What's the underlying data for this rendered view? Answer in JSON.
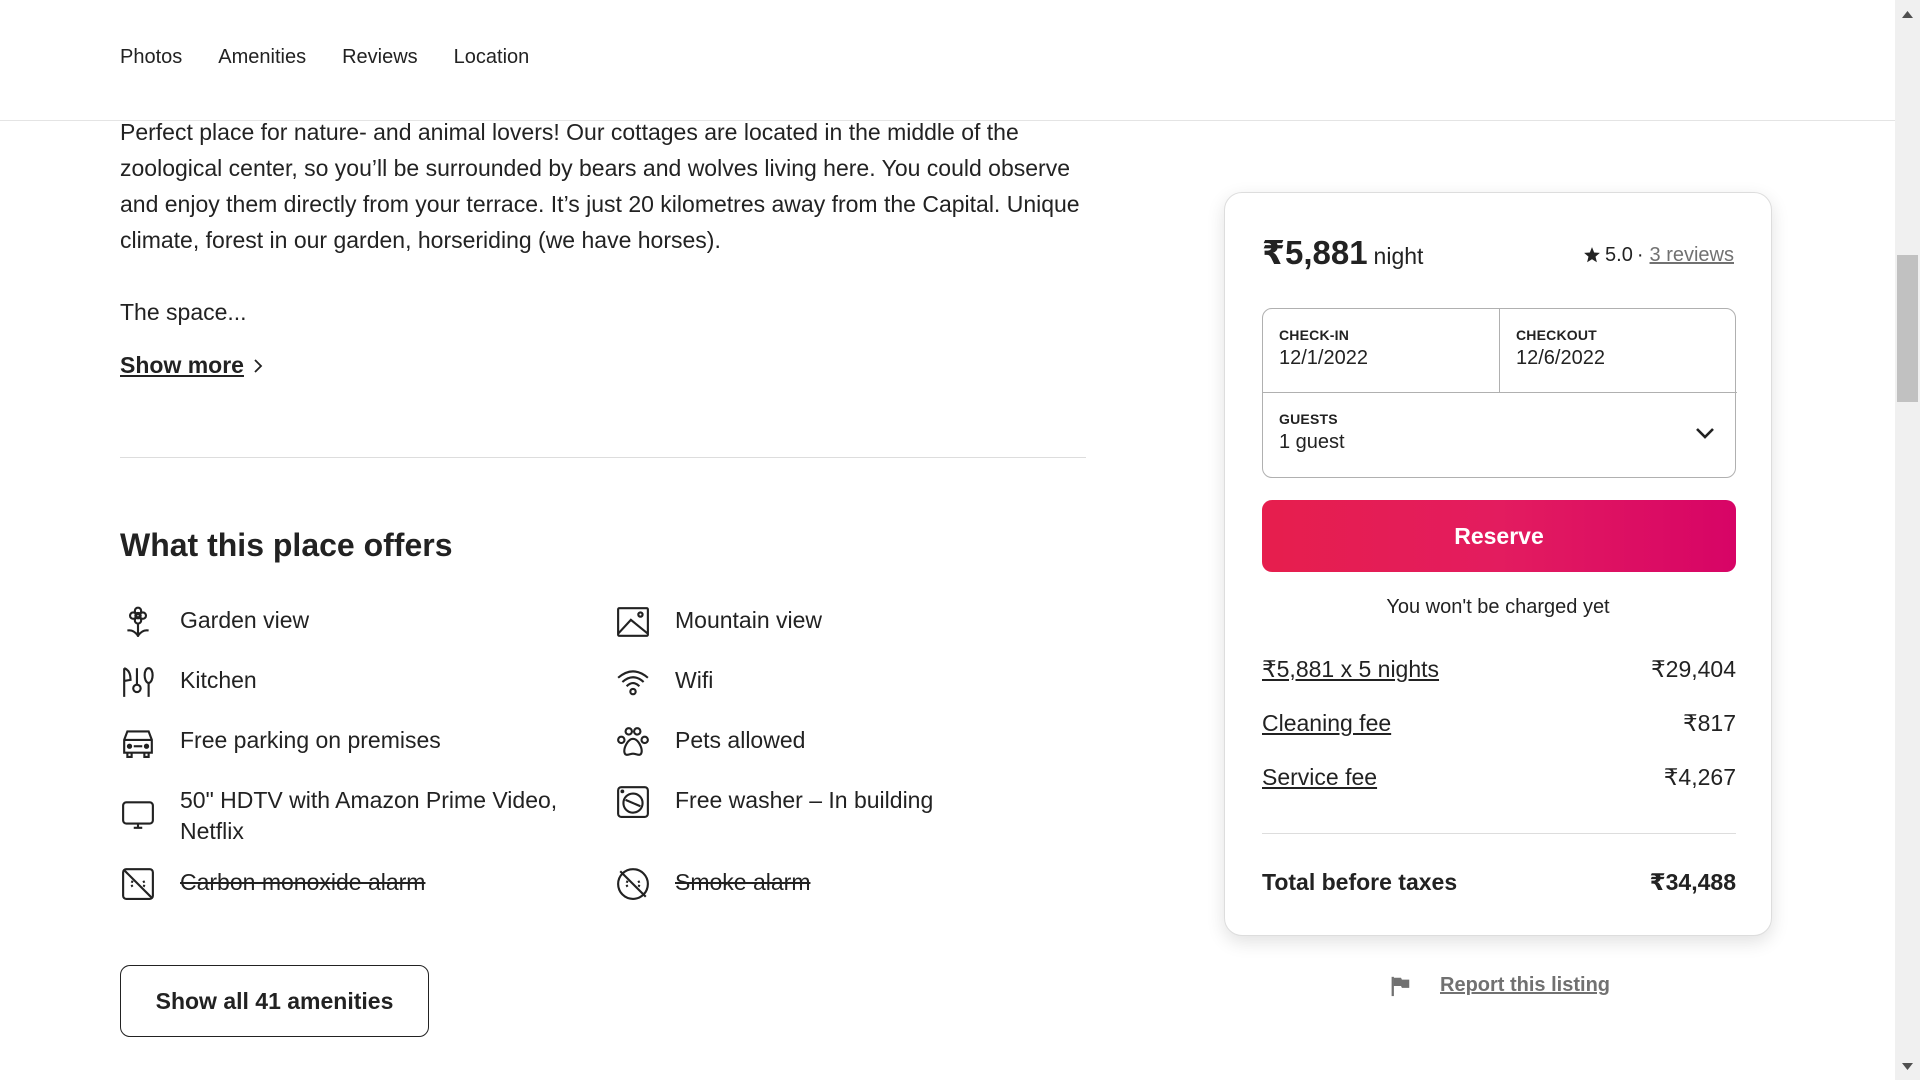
{
  "nav": {
    "tabs": [
      "Photos",
      "Amenities",
      "Reviews",
      "Location"
    ]
  },
  "description": {
    "text": "Perfect place for nature- and animal lovers! Our cottages are located in the middle of the zoological center,  so you’ll be surrounded by bears and wolves living here. You could observe and enjoy them directly from your terrace.  It’s just 20 kilometres  away from the Capital. Unique climate, forest in our garden, horseriding (we have horses).",
    "space": "The space...",
    "show_more": "Show more"
  },
  "amenities": {
    "title": "What this place offers",
    "items": [
      {
        "label": "Garden view",
        "icon": "flower-icon",
        "available": true
      },
      {
        "label": "Mountain view",
        "icon": "image-icon",
        "available": true
      },
      {
        "label": "Kitchen",
        "icon": "utensils-icon",
        "available": true
      },
      {
        "label": "Wifi",
        "icon": "wifi-icon",
        "available": true
      },
      {
        "label": "Free parking on premises",
        "icon": "car-icon",
        "available": true
      },
      {
        "label": "Pets allowed",
        "icon": "paw-icon",
        "available": true
      },
      {
        "label": "50\" HDTV with Amazon Prime Video, Netflix",
        "icon": "tv-icon",
        "available": true
      },
      {
        "label": "Free washer – In building",
        "icon": "washer-icon",
        "available": true
      },
      {
        "label": "Carbon monoxide alarm",
        "icon": "co-alarm-off-icon",
        "available": false
      },
      {
        "label": "Smoke alarm",
        "icon": "smoke-alarm-off-icon",
        "available": false
      }
    ],
    "show_all": "Show all 41 amenities"
  },
  "booking": {
    "price": "₹5,881",
    "per": "night",
    "rating": "5.0",
    "separator": "·",
    "reviews": "3 reviews",
    "checkin_label": "CHECK-IN",
    "checkin_value": "12/1/2022",
    "checkout_label": "CHECKOUT",
    "checkout_value": "12/6/2022",
    "guests_label": "GUESTS",
    "guests_value": "1 guest",
    "reserve": "Reserve",
    "note": "You won't be charged yet",
    "fees": [
      {
        "label": "₹5,881 x 5 nights",
        "amount": "₹29,404"
      },
      {
        "label": "Cleaning fee",
        "amount": "₹817"
      },
      {
        "label": "Service fee",
        "amount": "₹4,267"
      }
    ],
    "total_label": "Total before taxes",
    "total_amount": "₹34,488",
    "accent_color": "#e31c5f"
  },
  "report": {
    "label": "Report this listing"
  }
}
